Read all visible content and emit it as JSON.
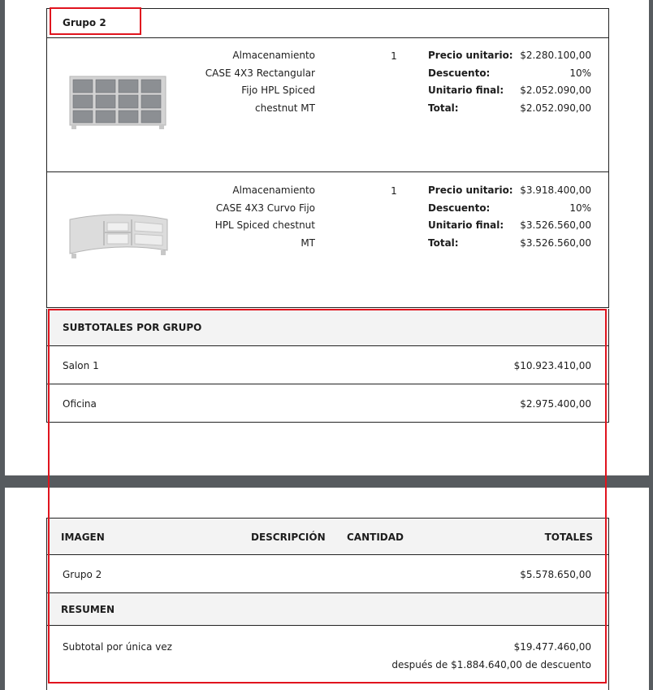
{
  "group": {
    "title": "Grupo 2"
  },
  "products": [
    {
      "image": "storage-case-4x3-rectangular",
      "description": [
        "Almacenamiento",
        "CASE 4X3 Rectangular",
        "Fijo HPL Spiced",
        "chestnut MT"
      ],
      "quantity": "1",
      "labels": [
        "Precio unitario:",
        "Descuento:",
        "Unitario final:",
        "Total:"
      ],
      "values": [
        "$2.280.100,00",
        "10%",
        "$2.052.090,00",
        "$2.052.090,00"
      ]
    },
    {
      "image": "storage-case-4x3-curved",
      "description": [
        "Almacenamiento",
        "CASE 4X3 Curvo Fijo",
        "HPL Spiced chestnut",
        "MT"
      ],
      "quantity": "1",
      "labels": [
        "Precio unitario:",
        "Descuento:",
        "Unitario final:",
        "Total:"
      ],
      "values": [
        "$3.918.400,00",
        "10%",
        "$3.526.560,00",
        "$3.526.560,00"
      ]
    }
  ],
  "subtotals": {
    "heading": "SUBTOTALES POR GRUPO",
    "rows": [
      {
        "label": "Salon 1",
        "value": "$10.923.410,00"
      },
      {
        "label": "Oficina",
        "value": "$2.975.400,00"
      }
    ]
  },
  "summary_table": {
    "headers": {
      "image": "IMAGEN",
      "description": "DESCRIPCIÓN",
      "quantity": "CANTIDAD",
      "totals": "TOTALES"
    },
    "group_row": {
      "label": "Grupo 2",
      "value": "$5.578.650,00"
    },
    "resumen_heading": "RESUMEN",
    "subtotal_label": "Subtotal por única vez",
    "subtotal_value": "$19.477.460,00",
    "discount_note": "después de $1.884.640,00 de descuento"
  },
  "colors": {
    "highlight": "#e0141e",
    "shade": "#f3f3f3",
    "viewer_bg": "#575b5f"
  }
}
